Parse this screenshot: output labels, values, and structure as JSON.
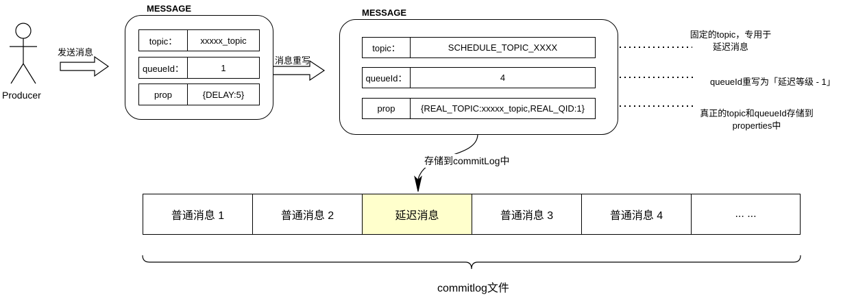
{
  "producer": {
    "label": "Producer"
  },
  "arrows": {
    "send_label": "发送消息",
    "rewrite_label": "消息重写",
    "store_label": "存储到commitLog中"
  },
  "original_message": {
    "title": "MESSAGE",
    "rows": [
      {
        "key": "topic：",
        "value": "xxxxx_topic"
      },
      {
        "key": "queueId：",
        "value": "1"
      },
      {
        "key": "prop",
        "value": "{DELAY:5}"
      }
    ]
  },
  "rewritten_message": {
    "title": "MESSAGE",
    "rows": [
      {
        "key": "topic：",
        "value": "SCHEDULE_TOPIC_XXXX"
      },
      {
        "key": "queueId：",
        "value": "4"
      },
      {
        "key": "prop",
        "value": "{REAL_TOPIC:xxxxx_topic,REAL_QID:1}"
      }
    ]
  },
  "notes": [
    {
      "line1": "固定的topic，专用于",
      "line2": "延迟消息"
    },
    {
      "line1": "queueId重写为「延迟等级 - 1」",
      "line2": ""
    },
    {
      "line1": "真正的topic和queueId存储到",
      "line2": "properties中"
    }
  ],
  "commitlog": {
    "cells": [
      "普通消息 1",
      "普通消息 2",
      "延迟消息",
      "普通消息 3",
      "普通消息 4",
      "... ..."
    ],
    "highlight_index": 2,
    "highlight_color": "#ffffcc",
    "label": "commitlog文件"
  }
}
